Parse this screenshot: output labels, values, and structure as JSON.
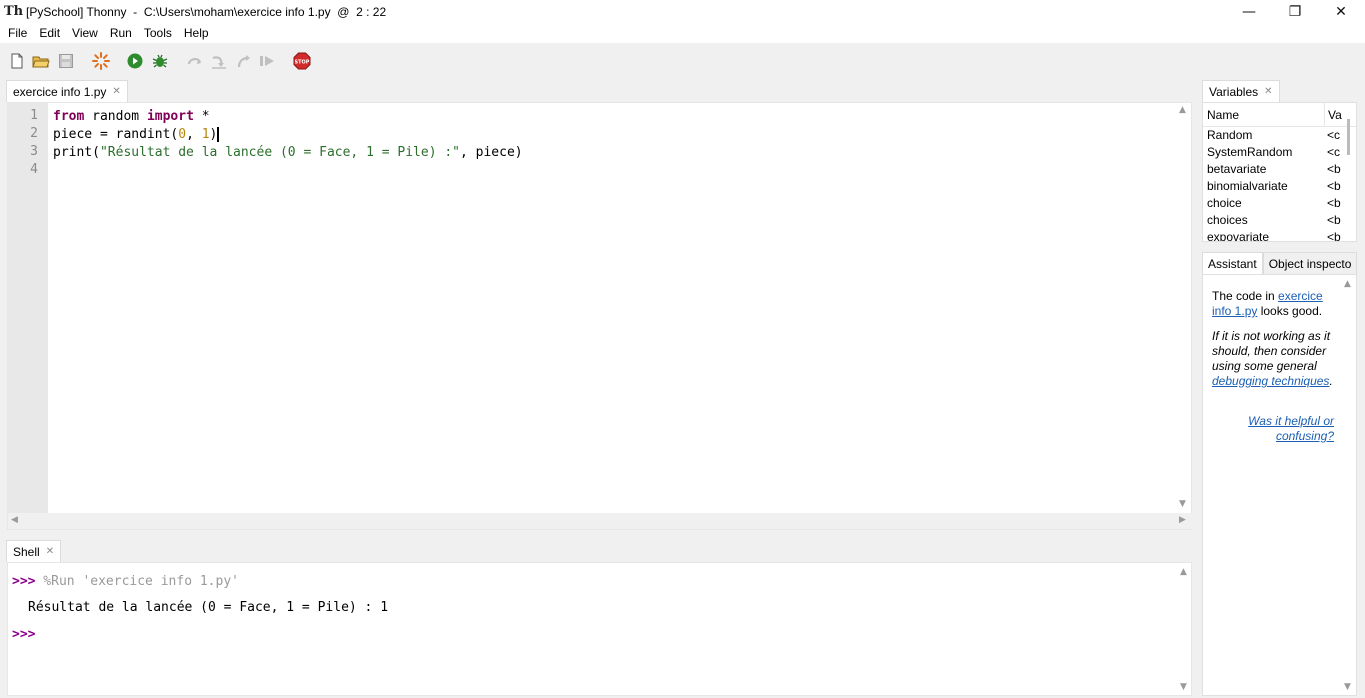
{
  "window": {
    "title": "[PySchool] Thonny  -  C:\\Users\\moham\\exercice info 1.py  @  2 : 22",
    "minimize": "—",
    "maximize": "❐",
    "close": "✕"
  },
  "menu": [
    "File",
    "Edit",
    "View",
    "Run",
    "Tools",
    "Help"
  ],
  "toolbar": {
    "icons": [
      "new-file-icon",
      "open-folder-icon",
      "save-icon",
      "load-plugin-icon",
      "run-icon",
      "debug-icon",
      "step-over-icon",
      "step-into-icon",
      "step-out-icon",
      "resume-icon",
      "stop-icon"
    ],
    "colors": {
      "run": "#2e8b2e",
      "stop": "#d22b2b",
      "load": "#e07020"
    }
  },
  "editor": {
    "tab_label": "exercice info 1.py",
    "line_numbers": [
      "1",
      "2",
      "3",
      "4"
    ],
    "lines": {
      "l1_kw1": "from",
      "l1_mid": " random ",
      "l1_kw2": "import",
      "l1_end": " *",
      "l2_a": "piece = randint(",
      "l2_n0": "0",
      "l2_b": ", ",
      "l2_n1": "1",
      "l2_c": ")",
      "l3_a": "print(",
      "l3_str": "\"Résultat de la lancée (0 = Face, 1 = Pile) :\"",
      "l3_b": ", piece)"
    }
  },
  "shell": {
    "tab_label": "Shell",
    "prompt": ">>>",
    "command": " %Run 'exercice info 1.py'",
    "output": "Résultat de la lancée (0 = Face, 1 = Pile) : 1"
  },
  "variables": {
    "tab_label": "Variables",
    "col_name": "Name",
    "col_value": "Va",
    "rows": [
      {
        "name": "Random",
        "value": "<c"
      },
      {
        "name": "SystemRandom",
        "value": "<c"
      },
      {
        "name": "betavariate",
        "value": "<b"
      },
      {
        "name": "binomialvariate",
        "value": "<b"
      },
      {
        "name": "choice",
        "value": "<b"
      },
      {
        "name": "choices",
        "value": "<b"
      },
      {
        "name": "expovariate",
        "value": "<b"
      }
    ]
  },
  "assistant": {
    "tab_assistant": "Assistant",
    "tab_inspector": "Object inspecto",
    "p1_a": "The code in ",
    "p1_link": "exercice info 1.py",
    "p1_b": " looks good.",
    "p2_a": "If it is not working as it should, then consider using some general ",
    "p2_link": "debugging techniques",
    "p2_b": ".",
    "feedback": "Was it helpful or confusing?"
  }
}
